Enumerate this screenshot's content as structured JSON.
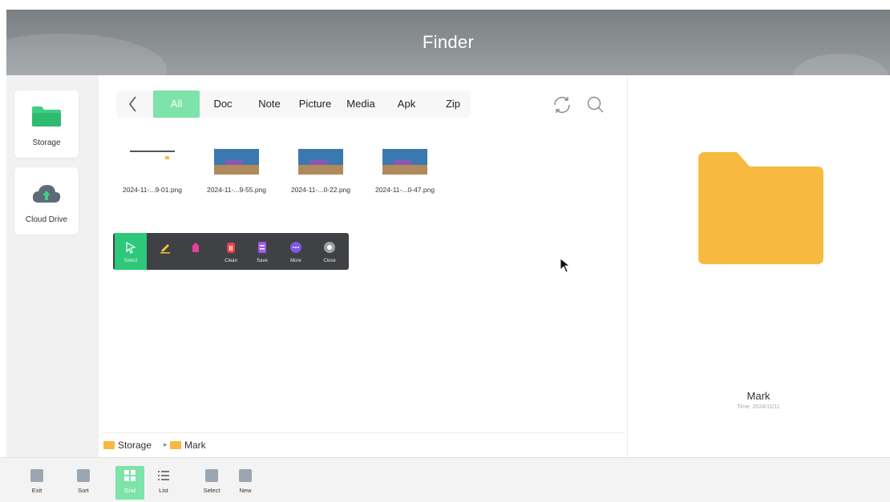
{
  "header": {
    "title": "Finder"
  },
  "sidebar": {
    "items": [
      {
        "label": "Storage",
        "icon": "folder-icon"
      },
      {
        "label": "Cloud Drive",
        "icon": "cloud-upload-icon"
      }
    ]
  },
  "tabs": [
    {
      "label": "All",
      "active": true
    },
    {
      "label": "Doc"
    },
    {
      "label": "Note"
    },
    {
      "label": "Picture"
    },
    {
      "label": "Media"
    },
    {
      "label": "Apk"
    },
    {
      "label": "Zip"
    }
  ],
  "files": [
    {
      "name": "2024-11-...9-01.png"
    },
    {
      "name": "2024-11-...9-55.png"
    },
    {
      "name": "2024-11-...0-22.png"
    },
    {
      "name": "2024-11-...0-47.png"
    }
  ],
  "annotation_toolbar": {
    "buttons": [
      {
        "caption": "Select",
        "icon": "pointer-icon"
      },
      {
        "caption": "",
        "icon": "pen-icon"
      },
      {
        "caption": "",
        "icon": "eraser-icon"
      },
      {
        "caption": "Clean",
        "icon": "trash-icon"
      },
      {
        "caption": "Save",
        "icon": "save-icon"
      },
      {
        "caption": "More",
        "icon": "more-icon"
      },
      {
        "caption": "Close",
        "icon": "close-icon"
      }
    ]
  },
  "breadcrumb": {
    "root": "Storage",
    "current": "Mark"
  },
  "preview": {
    "name": "Mark",
    "time": "Time: 2024/11/11"
  },
  "bottom_bar": {
    "buttons": [
      {
        "label": "Exit"
      },
      {
        "label": "Sort"
      },
      {
        "label": "Grid"
      },
      {
        "label": "List"
      },
      {
        "label": "Select"
      },
      {
        "label": "New"
      }
    ]
  },
  "colors": {
    "accent": "#7de3a8",
    "folder": "#f7b93f",
    "toolbar": "#3f4144",
    "active_tool": "#2dc87a"
  }
}
